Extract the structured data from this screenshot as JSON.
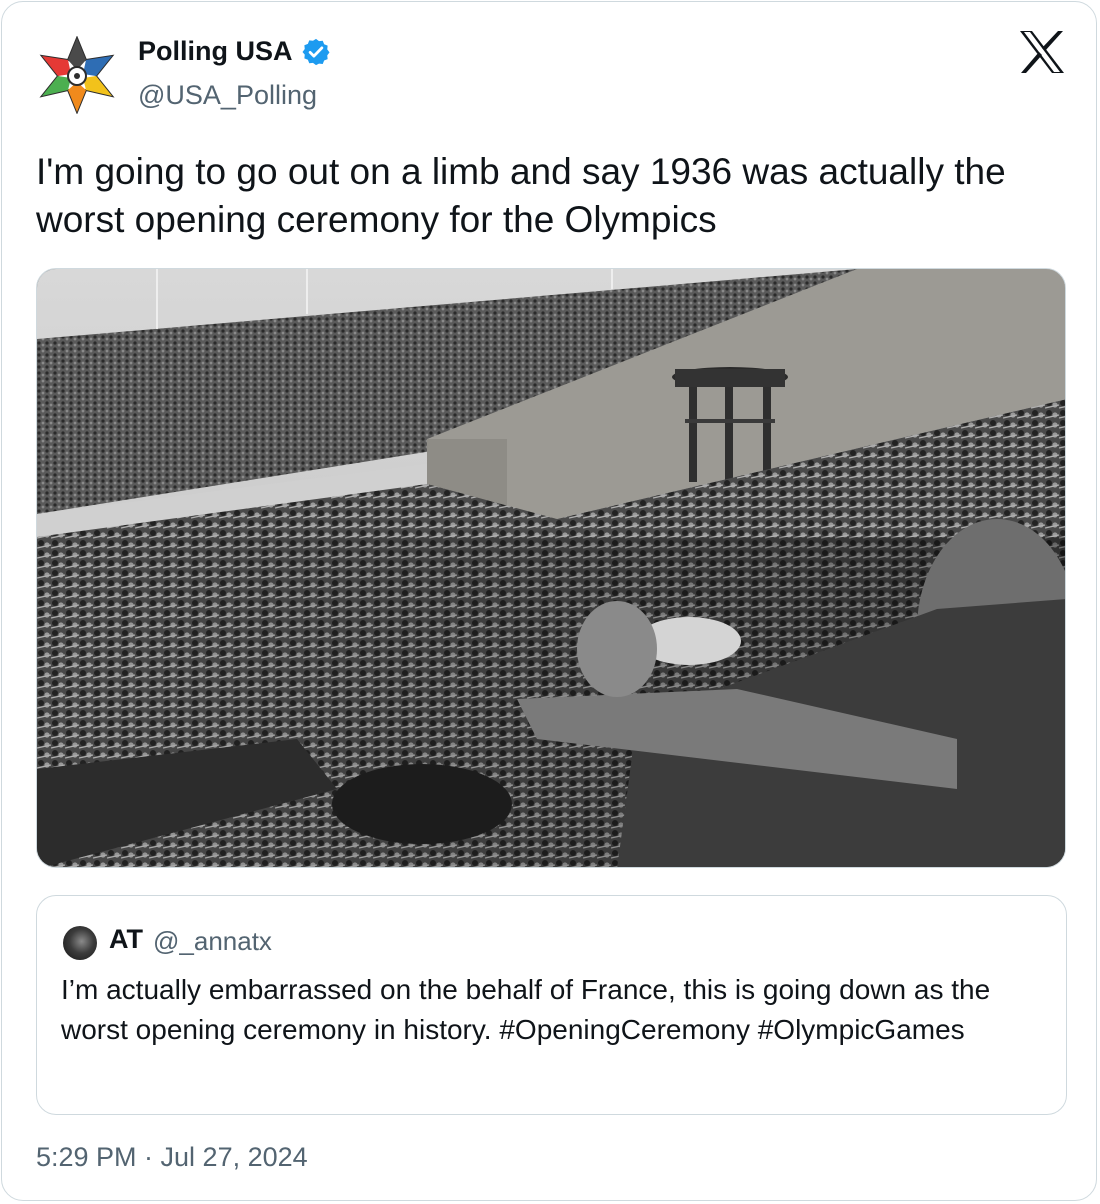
{
  "author": {
    "display_name": "Polling USA",
    "handle": "@USA_Polling",
    "verified": true
  },
  "tweet": {
    "text": "I'm going to go out on a limb and say 1936 was actually the worst opening ceremony for the Olympics",
    "timestamp": "5:29 PM · Jul 27, 2024"
  },
  "quoted_tweet": {
    "display_name": "AT",
    "handle": "@_annatx",
    "text": "I’m actually embarrassed on the behalf of France, this is going down as the worst opening ceremony in history. #OpeningCeremony #OlympicGames"
  },
  "icons": {
    "platform_logo": "x-logo-icon",
    "verified_badge": "verified-badge-icon"
  },
  "colors": {
    "text_primary": "#0f1419",
    "text_secondary": "#536471",
    "border": "#cfd9de",
    "verified_blue": "#1d9bf0"
  }
}
